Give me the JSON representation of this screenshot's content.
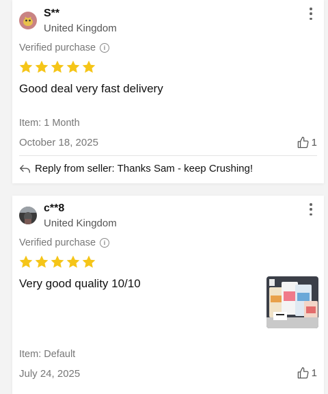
{
  "reviews": [
    {
      "username": "S**",
      "country": "United Kingdom",
      "verified_label": "Verified purchase",
      "rating": 5,
      "text": "Good deal very fast delivery",
      "item": "Item: 1 Month",
      "date": "October 18, 2025",
      "helpful_count": "1",
      "reply": "Reply from seller: Thanks Sam - keep Crushing!"
    },
    {
      "username": "c**8",
      "country": "United Kingdom",
      "verified_label": "Verified purchase",
      "rating": 5,
      "text": "Very good quality 10/10",
      "item": "Item: Default",
      "date": "July 24, 2025",
      "helpful_count": "1"
    }
  ],
  "colors": {
    "star": "#f5c518",
    "muted_text": "#777777",
    "card_bg": "#ffffff",
    "page_bg": "#f3f3f3"
  },
  "icons": {
    "more": "more-vertical-icon",
    "info": "info-icon",
    "star": "star-icon",
    "thumbs_up": "thumbs-up-icon",
    "reply": "reply-arrow-icon"
  }
}
